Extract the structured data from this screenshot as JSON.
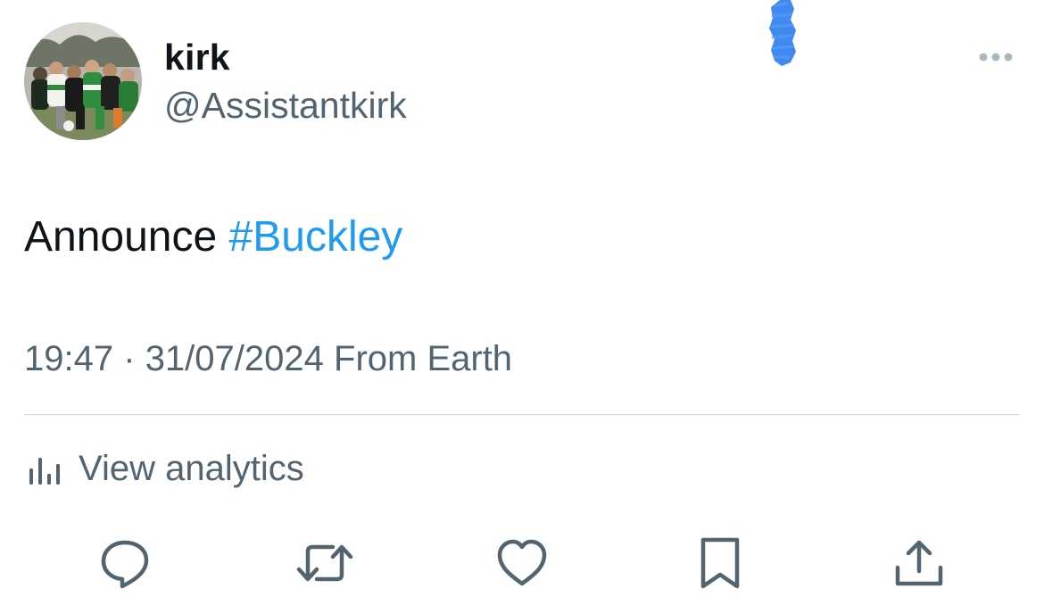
{
  "author": {
    "display_name": "kirk",
    "handle": "@Assistantkirk"
  },
  "tweet": {
    "text": "Announce",
    "hashtag": "#Buckley"
  },
  "meta": {
    "time": "19:47",
    "separator": "·",
    "date": "31/07/2024",
    "source": "From Earth"
  },
  "analytics": {
    "label": "View analytics",
    "icon": "bar-chart-icon"
  },
  "actions": [
    {
      "icon": "reply-icon"
    },
    {
      "icon": "retweet-icon"
    },
    {
      "icon": "like-icon"
    },
    {
      "icon": "bookmark-icon"
    },
    {
      "icon": "share-icon"
    }
  ],
  "colors": {
    "text_primary": "#0f1419",
    "text_secondary": "#536471",
    "accent": "#1d9bf0",
    "divider": "#cfd9de",
    "scribble": "#2f7ff0"
  }
}
